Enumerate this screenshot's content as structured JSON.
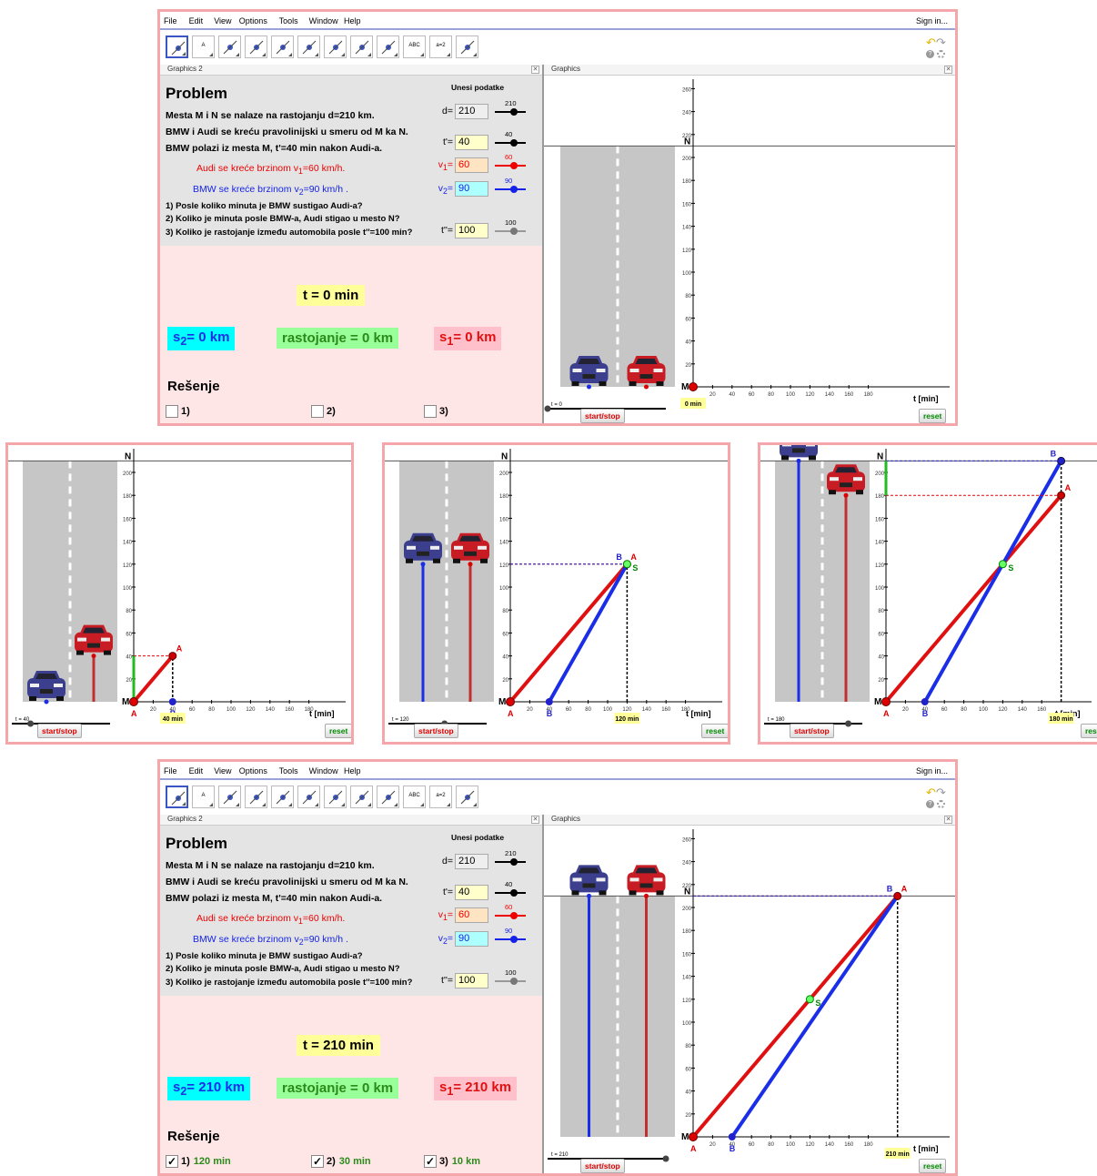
{
  "menu": [
    "File",
    "Edit",
    "View",
    "Options",
    "Tools",
    "Window",
    "Help"
  ],
  "sign_in": "Sign in...",
  "tools": [
    {
      "icon": "move-arrow-icon"
    },
    {
      "icon": "point-icon",
      "text": "A"
    },
    {
      "icon": "line-icon"
    },
    {
      "icon": "perpendicular-icon"
    },
    {
      "icon": "polygon-icon"
    },
    {
      "icon": "circle-icon"
    },
    {
      "icon": "conic-icon"
    },
    {
      "icon": "angle-icon"
    },
    {
      "icon": "reflect-icon"
    },
    {
      "icon": "text-icon",
      "text": "ABC"
    },
    {
      "icon": "slider-icon",
      "text": "a=2"
    },
    {
      "icon": "move-view-icon"
    }
  ],
  "panels": {
    "left": "Graphics 2",
    "right": "Graphics",
    "close": "✕"
  },
  "problem": {
    "title": "Problem",
    "line1": "Mesta M i N se nalaze na rastojanju d=210 km.",
    "line2": "BMW i Audi se kreću pravolinijski u smeru od M ka N.",
    "line3": "BMW polazi iz mesta M, t'=40 min nakon Audi-a.",
    "audi": "Audi se kreće brzinom v",
    "audi_sub": "1",
    "audi_end": "=60 km/h.",
    "bmw": "BMW se kreće brzinom v",
    "bmw_sub": "2",
    "bmw_end": "=90 km/h  .",
    "q1": "1)  Posle koliko minuta je BMW sustigao Audi-a?",
    "q2": "2)  Koliko je minuta posle BMW-a, Audi stigao u mesto N?",
    "q3": "3)  Koliko je rastojanje između automobila posle  t''=100 min?"
  },
  "inputs": {
    "header": "Unesi podatke",
    "d": {
      "label": "d=",
      "value": "210",
      "slider": "210"
    },
    "tp": {
      "label": "t'=",
      "value": "40",
      "slider": "40"
    },
    "v1": {
      "label": "v",
      "sub": "1",
      "eq": "=",
      "value": "60",
      "slider": "60"
    },
    "v2": {
      "label": "v",
      "sub": "2",
      "eq": "=",
      "value": "90",
      "slider": "90"
    },
    "tpp": {
      "label": "t''=",
      "value": "100",
      "slider": "100"
    }
  },
  "colors": {
    "audi": "#e01010",
    "bmw": "#1a2ee8",
    "gap": "#22bb22",
    "road": "#c6c6c6",
    "bg_pink": "#ffe6e6",
    "yellow": "#ffff99",
    "cyan": "#00ffff",
    "green_box": "#99ff99",
    "pink_box": "#ffc0cb"
  },
  "resenje": "Rešenje",
  "axis": {
    "t_label": "t [min]",
    "M": "M",
    "N": "N",
    "y_ticks": [
      "20",
      "40",
      "60",
      "80",
      "100",
      "120",
      "140",
      "160",
      "180",
      "200",
      "220",
      "240",
      "260"
    ],
    "x_ticks": [
      "20",
      "40",
      "60",
      "80",
      "100",
      "120",
      "140",
      "160",
      "180"
    ]
  },
  "buttons": {
    "start": "start/stop",
    "reset": "reset"
  },
  "states": [
    {
      "t": 0,
      "t_text": "t = 0 min",
      "s2_text": "= 0 km",
      "dist_text": "rastojanje =  0 km",
      "s1_text": "= 0 km",
      "slider_label": "t = 0",
      "time_badge": "0 min",
      "answers": [
        "",
        "",
        ""
      ],
      "checked": [
        false,
        false,
        false
      ]
    },
    {
      "t": 40,
      "slider_label": "t = 40",
      "time_badge": "40 min"
    },
    {
      "t": 120,
      "slider_label": "t = 120",
      "time_badge": "120 min"
    },
    {
      "t": 180,
      "slider_label": "t = 180",
      "time_badge": "180 min"
    },
    {
      "t": 210,
      "t_text": "t = 210 min",
      "s2_text": "= 210 km",
      "dist_text": "rastojanje =  0 km",
      "s1_text": "= 210 km",
      "slider_label": "t = 210",
      "time_badge": "210 min",
      "answers": [
        "120 min",
        "30 min",
        "10 km"
      ],
      "checked": [
        true,
        true,
        true
      ]
    }
  ],
  "labels": {
    "s": "s",
    "s2_sub": "2",
    "s1_sub": "1",
    "A": "A",
    "B": "B",
    "A1": "A",
    "B1": "B",
    "sub1": "1",
    "S": "S",
    "q": [
      "1)",
      "2)",
      "3)"
    ]
  },
  "physics": {
    "d": 210,
    "t_delay": 40,
    "v1": 60,
    "v2": 90
  }
}
